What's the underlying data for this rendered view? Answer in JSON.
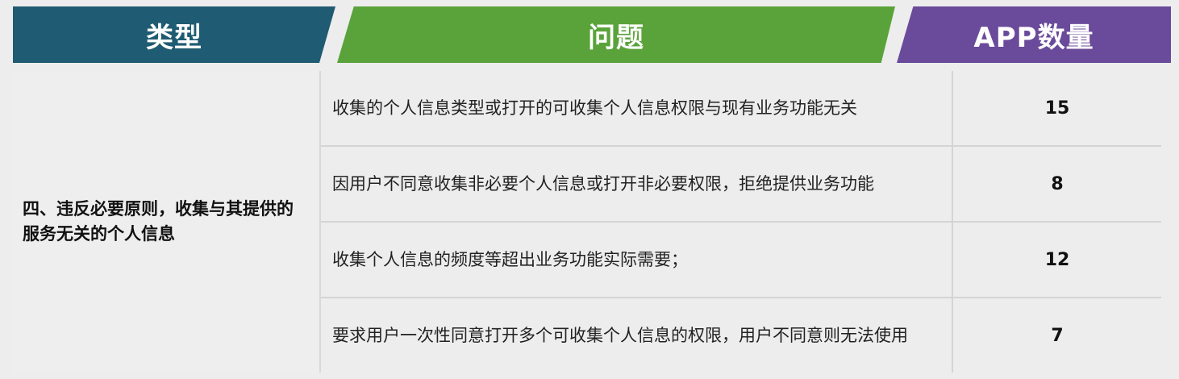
{
  "header": {
    "type_label": "类型",
    "issue_label": "问题",
    "count_label": "APP数量"
  },
  "category": "四、违反必要原则，收集与其提供的服务无关的个人信息",
  "rows": [
    {
      "issue": "收集的个人信息类型或打开的可收集个人信息权限与现有业务功能无关",
      "count": "15"
    },
    {
      "issue": "因用户不同意收集非必要个人信息或打开非必要权限，拒绝提供业务功能",
      "count": "8"
    },
    {
      "issue": "收集个人信息的频度等超出业务功能实际需要；",
      "count": "12"
    },
    {
      "issue": "要求用户一次性同意打开多个可收集个人信息的权限，用户不同意则无法使用",
      "count": "7"
    }
  ],
  "colors": {
    "type_header": "#1f5b72",
    "issue_header": "#5aa33a",
    "count_header": "#6a4a9a"
  }
}
